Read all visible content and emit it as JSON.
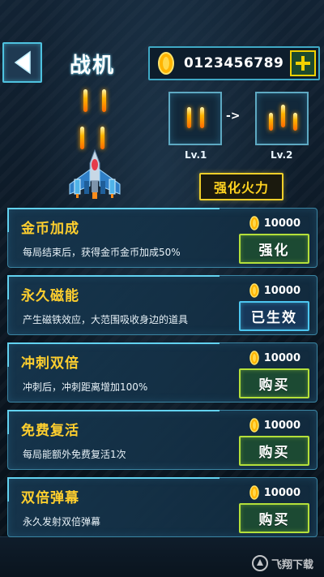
{
  "header": {
    "title": "战机",
    "coins": "0123456789",
    "back_icon": "back-arrow-icon",
    "plus_icon": "plus-icon"
  },
  "weapon": {
    "level_from": "Lv.1",
    "level_to": "Lv.2",
    "arrow_text": "->",
    "upgrade_label": "强化火力"
  },
  "upgrades": [
    {
      "title": "金币加成",
      "desc": "每局结束后，获得金币金币加成50%",
      "price": "10000",
      "button": "强化",
      "style": "green"
    },
    {
      "title": "永久磁能",
      "desc": "产生磁铁效应，大范围吸收身边的道具",
      "price": "10000",
      "button": "已生效",
      "style": "blue"
    },
    {
      "title": "冲刺双倍",
      "desc": "冲刺后，冲刺距离增加100%",
      "price": "10000",
      "button": "购买",
      "style": "green"
    },
    {
      "title": "免费复活",
      "desc": "每局能额外免费复活1次",
      "price": "10000",
      "button": "购买",
      "style": "green"
    },
    {
      "title": "双倍弹幕",
      "desc": "永久发射双倍弹幕",
      "price": "10000",
      "button": "购买",
      "style": "green"
    }
  ],
  "colors": {
    "accent_cyan": "#4ec2df",
    "title_gold": "#ffcf2e",
    "button_green": "#b4e03a",
    "button_blue": "#4cc6f0",
    "coin_gold": "#ffb400"
  },
  "watermark": "飞翔下载"
}
